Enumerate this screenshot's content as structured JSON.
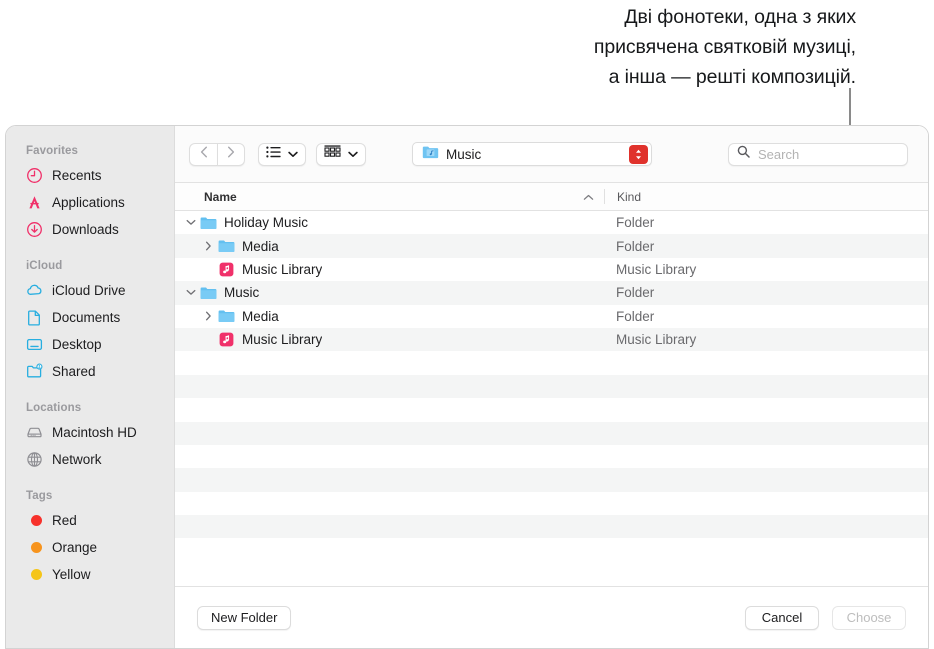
{
  "annotation": {
    "lines": [
      "Дві фонотеки, одна з яких",
      "присвячена святковій музиці,",
      "а інша — решті композицій."
    ],
    "leader_color": "#8a8a8a"
  },
  "sidebar": {
    "sections": [
      {
        "header": "Favorites",
        "items": [
          {
            "label": "Recents",
            "icon": "clock-icon",
            "color": "#f0316a"
          },
          {
            "label": "Applications",
            "icon": "applications-icon",
            "color": "#f0316a"
          },
          {
            "label": "Downloads",
            "icon": "download-circle-icon",
            "color": "#f0316a"
          }
        ]
      },
      {
        "header": "iCloud",
        "items": [
          {
            "label": "iCloud Drive",
            "icon": "cloud-icon",
            "color": "#27aee0"
          },
          {
            "label": "Documents",
            "icon": "document-icon",
            "color": "#27aee0"
          },
          {
            "label": "Desktop",
            "icon": "desktop-icon",
            "color": "#27aee0"
          },
          {
            "label": "Shared",
            "icon": "shared-folder-icon",
            "color": "#27aee0"
          }
        ]
      },
      {
        "header": "Locations",
        "items": [
          {
            "label": "Macintosh HD",
            "icon": "hard-drive-icon",
            "color": "#8e8e93"
          },
          {
            "label": "Network",
            "icon": "globe-icon",
            "color": "#8e8e93"
          }
        ]
      },
      {
        "header": "Tags",
        "items": [
          {
            "label": "Red",
            "icon": "tag-dot-icon",
            "color": "#f7312b"
          },
          {
            "label": "Orange",
            "icon": "tag-dot-icon",
            "color": "#f7941d"
          },
          {
            "label": "Yellow",
            "icon": "tag-dot-icon",
            "color": "#f5c518"
          }
        ]
      }
    ]
  },
  "toolbar": {
    "back_icon": "chevron-left-icon",
    "forward_icon": "chevron-right-icon",
    "list_view_icon": "list-view-icon",
    "group_view_icon": "icon-view-icon",
    "path_label": "Music",
    "path_folder_icon": "music-folder-icon",
    "stepper_icon": "up-down-stepper-icon",
    "stepper_color": "#e0322c",
    "search_icon": "search-icon",
    "search_value": "",
    "search_placeholder": "Search"
  },
  "columns": {
    "name": "Name",
    "kind": "Kind",
    "sort_icon": "chevron-up-icon"
  },
  "rows": [
    {
      "name": "Holiday Music",
      "kind": "Folder",
      "indent": 0,
      "icon": "folder-icon",
      "disclosure": "open"
    },
    {
      "name": "Media",
      "kind": "Folder",
      "indent": 1,
      "icon": "folder-icon",
      "disclosure": "closed"
    },
    {
      "name": "Music Library",
      "kind": "Music Library",
      "indent": 1,
      "icon": "music-library-icon",
      "disclosure": "none"
    },
    {
      "name": "Music",
      "kind": "Folder",
      "indent": 0,
      "icon": "folder-icon",
      "disclosure": "open"
    },
    {
      "name": "Media",
      "kind": "Folder",
      "indent": 1,
      "icon": "folder-icon",
      "disclosure": "closed"
    },
    {
      "name": "Music Library",
      "kind": "Music Library",
      "indent": 1,
      "icon": "music-library-icon",
      "disclosure": "none"
    }
  ],
  "empty_row_count": 9,
  "footer": {
    "new_folder": "New Folder",
    "cancel": "Cancel",
    "choose": "Choose",
    "choose_disabled": true
  }
}
